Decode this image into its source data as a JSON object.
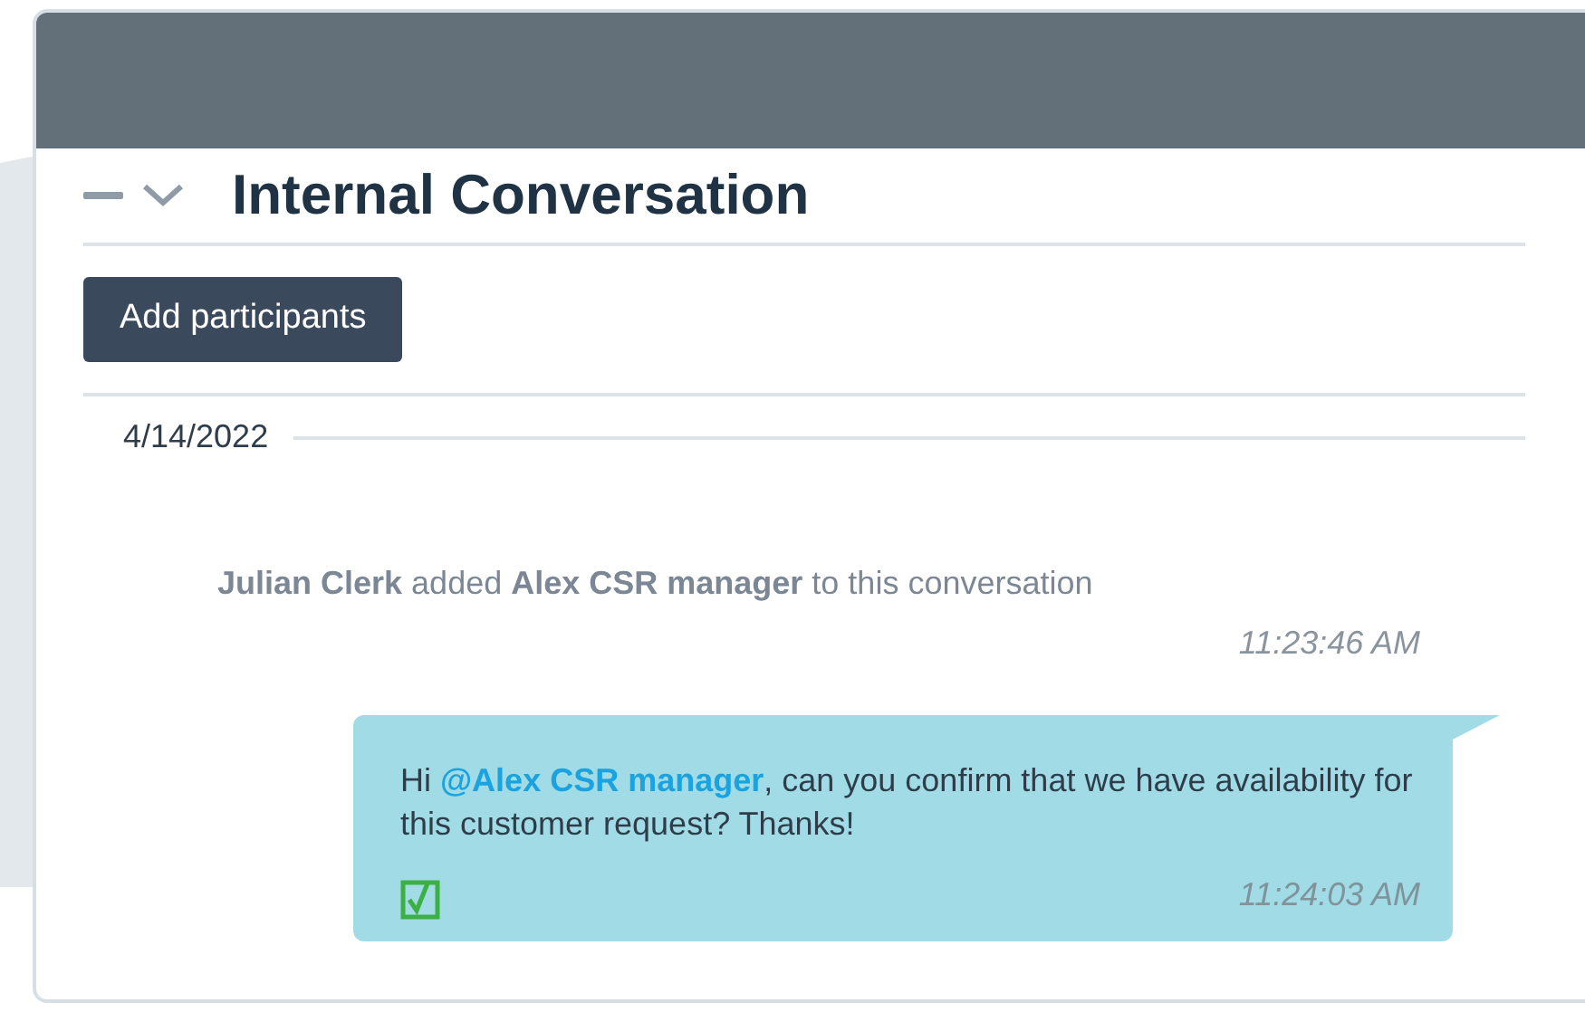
{
  "panel": {
    "title": "Internal Conversation",
    "collapsed": false
  },
  "add_button": {
    "label": "Add participants"
  },
  "date": "4/14/2022",
  "events": [
    {
      "kind": "system",
      "text": "**Julian Clerk** added **Alex CSR manager** to this conversation",
      "time": "11:23:46 AM"
    },
    {
      "kind": "message",
      "text": "Hi **@Alex CSR manager**, can you confirm that we have availability for this customer request? Thanks!",
      "time": "11:24:03 AM",
      "read": true
    }
  ]
}
